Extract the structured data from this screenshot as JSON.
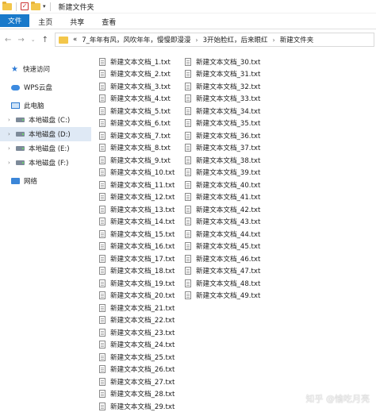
{
  "window": {
    "title": "新建文件夹"
  },
  "ribbon": {
    "tabs": [
      "文件",
      "主页",
      "共享",
      "查看"
    ]
  },
  "address": {
    "crumbs": [
      "«",
      "7_年年有风，风吹年年，慢慢即漫漫",
      "3开始脸红，后来眼红",
      "新建文件夹"
    ]
  },
  "sidebar": {
    "items": [
      {
        "label": "快速访问",
        "icon": "star-icon"
      },
      {
        "label": "WPS云盘",
        "icon": "cloud-icon"
      },
      {
        "label": "此电脑",
        "icon": "computer-icon"
      },
      {
        "label": "本地磁盘 (C:)",
        "icon": "drive-icon"
      },
      {
        "label": "本地磁盘 (D:)",
        "icon": "drive-icon",
        "selected": true
      },
      {
        "label": "本地磁盘 (E:)",
        "icon": "drive-icon"
      },
      {
        "label": "本地磁盘 (F:)",
        "icon": "drive-icon"
      },
      {
        "label": "网络",
        "icon": "network-icon"
      }
    ]
  },
  "files": [
    "新建文本文档_1.txt",
    "新建文本文档_2.txt",
    "新建文本文档_3.txt",
    "新建文本文档_4.txt",
    "新建文本文档_5.txt",
    "新建文本文档_6.txt",
    "新建文本文档_7.txt",
    "新建文本文档_8.txt",
    "新建文本文档_9.txt",
    "新建文本文档_10.txt",
    "新建文本文档_11.txt",
    "新建文本文档_12.txt",
    "新建文本文档_13.txt",
    "新建文本文档_14.txt",
    "新建文本文档_15.txt",
    "新建文本文档_16.txt",
    "新建文本文档_17.txt",
    "新建文本文档_18.txt",
    "新建文本文档_19.txt",
    "新建文本文档_20.txt",
    "新建文本文档_21.txt",
    "新建文本文档_22.txt",
    "新建文本文档_23.txt",
    "新建文本文档_24.txt",
    "新建文本文档_25.txt",
    "新建文本文档_26.txt",
    "新建文本文档_27.txt",
    "新建文本文档_28.txt",
    "新建文本文档_29.txt",
    "新建文本文档_30.txt",
    "新建文本文档_31.txt",
    "新建文本文档_32.txt",
    "新建文本文档_33.txt",
    "新建文本文档_34.txt",
    "新建文本文档_35.txt",
    "新建文本文档_36.txt",
    "新建文本文档_37.txt",
    "新建文本文档_38.txt",
    "新建文本文档_39.txt",
    "新建文本文档_40.txt",
    "新建文本文档_41.txt",
    "新建文本文档_42.txt",
    "新建文本文档_43.txt",
    "新建文本文档_44.txt",
    "新建文本文档_45.txt",
    "新建文本文档_46.txt",
    "新建文本文档_47.txt",
    "新建文本文档_48.txt",
    "新建文本文档_49.txt"
  ],
  "watermark": "知乎 @愉吃月亮",
  "colors": {
    "accent": "#1979ca",
    "selection": "#dfe9f5",
    "folder": "#f3c64a"
  }
}
